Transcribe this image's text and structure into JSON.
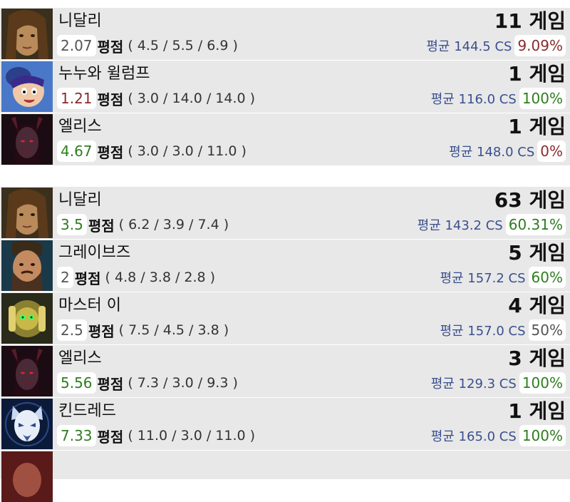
{
  "sections": [
    {
      "rows": [
        {
          "champion": "니달리",
          "kda": "2.07",
          "kda_color": "#555555",
          "kda_label": "평점",
          "kda_detail": "( 4.5 / 5.5 / 6.9 )",
          "games": "11 게임",
          "cs": "평균 144.5 CS",
          "winrate": "9.09%",
          "winrate_color": "#8a2b2b",
          "icon": "nidalee-portrait-icon"
        },
        {
          "champion": "누누와 윌럼프",
          "kda": "1.21",
          "kda_color": "#8a2b2b",
          "kda_label": "평점",
          "kda_detail": "( 3.0 / 14.0 / 14.0 )",
          "games": "1 게임",
          "cs": "평균 116.0 CS",
          "winrate": "100%",
          "winrate_color": "#2e7d1e",
          "icon": "nunu-willump-portrait-icon"
        },
        {
          "champion": "엘리스",
          "kda": "4.67",
          "kda_color": "#2e7d1e",
          "kda_label": "평점",
          "kda_detail": "( 3.0 / 3.0 / 11.0 )",
          "games": "1 게임",
          "cs": "평균 148.0 CS",
          "winrate": "0%",
          "winrate_color": "#8a2b2b",
          "icon": "elise-portrait-icon"
        }
      ]
    },
    {
      "rows": [
        {
          "champion": "니달리",
          "kda": "3.5",
          "kda_color": "#2e7d1e",
          "kda_label": "평점",
          "kda_detail": "( 6.2 / 3.9 / 7.4 )",
          "games": "63 게임",
          "cs": "평균 143.2 CS",
          "winrate": "60.31%",
          "winrate_color": "#2e7d1e",
          "icon": "nidalee-portrait-icon"
        },
        {
          "champion": "그레이브즈",
          "kda": "2",
          "kda_color": "#555555",
          "kda_label": "평점",
          "kda_detail": "( 4.8 / 3.8 / 2.8 )",
          "games": "5 게임",
          "cs": "평균 157.2 CS",
          "winrate": "60%",
          "winrate_color": "#2e7d1e",
          "icon": "graves-portrait-icon"
        },
        {
          "champion": "마스터 이",
          "kda": "2.5",
          "kda_color": "#555555",
          "kda_label": "평점",
          "kda_detail": "( 7.5 / 4.5 / 3.8 )",
          "games": "4 게임",
          "cs": "평균 157.0 CS",
          "winrate": "50%",
          "winrate_color": "#555555",
          "icon": "master-yi-portrait-icon"
        },
        {
          "champion": "엘리스",
          "kda": "5.56",
          "kda_color": "#2e7d1e",
          "kda_label": "평점",
          "kda_detail": "( 7.3 / 3.0 / 9.3 )",
          "games": "3 게임",
          "cs": "평균 129.3 CS",
          "winrate": "100%",
          "winrate_color": "#2e7d1e",
          "icon": "elise-portrait-icon"
        },
        {
          "champion": "킨드레드",
          "kda": "7.33",
          "kda_color": "#2e7d1e",
          "kda_label": "평점",
          "kda_detail": "( 11.0 / 3.0 / 11.0 )",
          "games": "1 게임",
          "cs": "평균 165.0 CS",
          "winrate": "100%",
          "winrate_color": "#2e7d1e",
          "icon": "kindred-portrait-icon"
        }
      ]
    }
  ]
}
